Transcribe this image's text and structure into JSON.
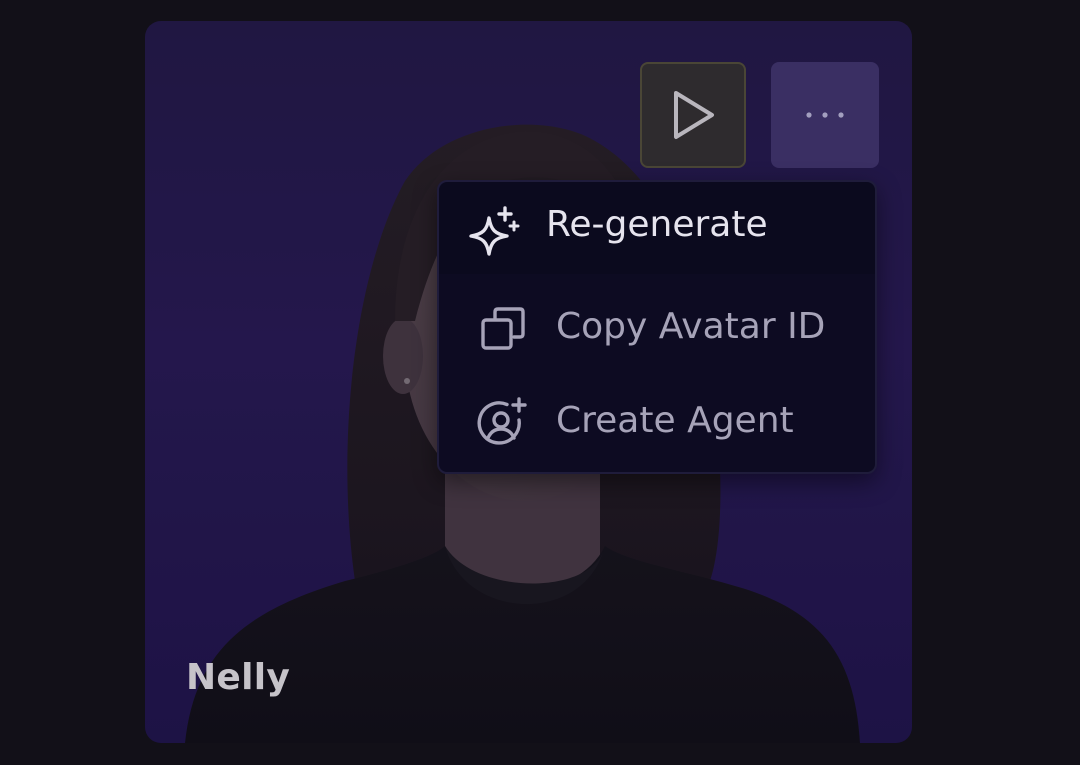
{
  "avatar": {
    "name": "Nelly"
  },
  "actions": {
    "play_icon": "play-icon",
    "more_icon": "more-horizontal-icon"
  },
  "menu": {
    "items": [
      {
        "label": "Re-generate",
        "icon": "sparkles-icon",
        "highlighted": true
      },
      {
        "label": "Copy Avatar ID",
        "icon": "copy-icon",
        "highlighted": false
      },
      {
        "label": "Create Agent",
        "icon": "user-plus-circle-icon",
        "highlighted": false
      }
    ]
  },
  "colors": {
    "page_background": "#121018",
    "card_background": "#2a1c58",
    "menu_background": "#0d0b22",
    "highlight_text": "#e6e4ee",
    "muted_text": "#a6a3b8"
  }
}
